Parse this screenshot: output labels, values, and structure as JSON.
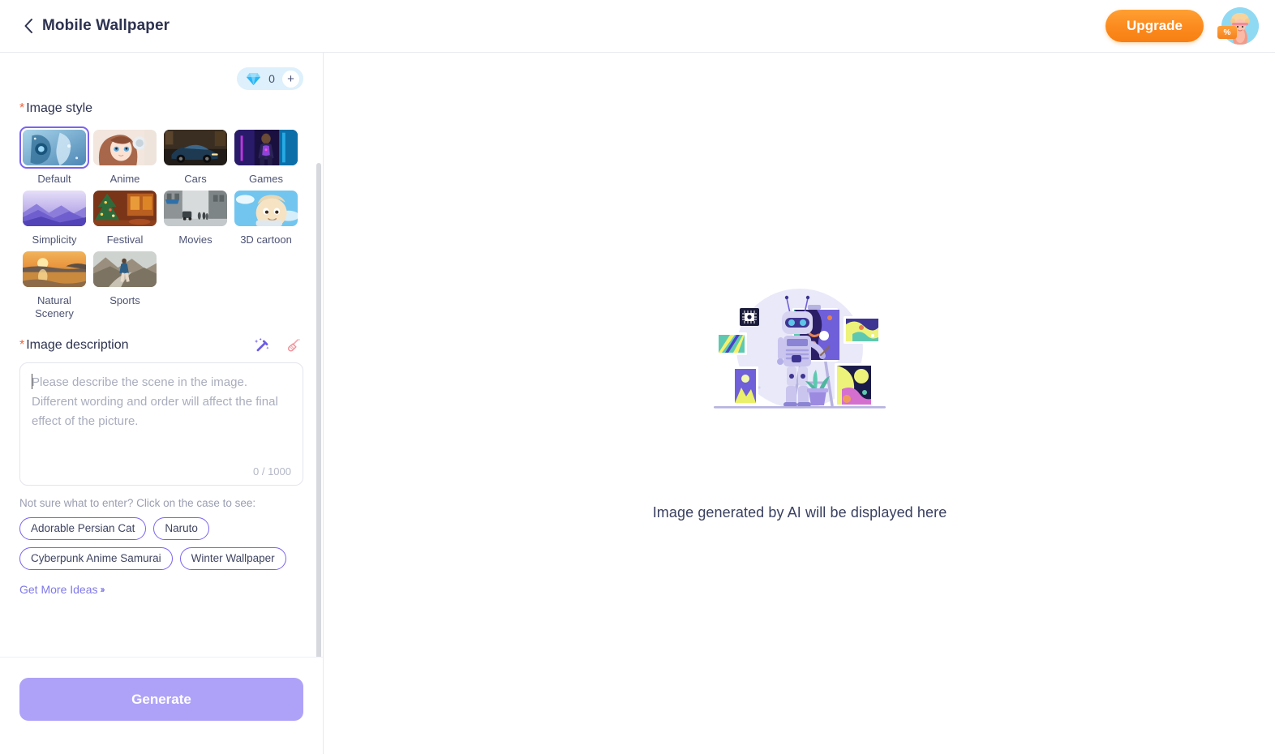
{
  "header": {
    "back_icon": "chevron-left-icon",
    "title": "Mobile Wallpaper",
    "upgrade_label": "Upgrade",
    "avatar_badge": "%",
    "avatar_name": "user-avatar"
  },
  "credits": {
    "icon": "diamond-icon",
    "count": "0",
    "add_label": "+"
  },
  "style_section": {
    "required_mark": "*",
    "label": "Image style",
    "selected_index": 0,
    "items": [
      {
        "label": "Default",
        "thumb": "cyborg-woman-blue"
      },
      {
        "label": "Anime",
        "thumb": "anime-girl-headphones"
      },
      {
        "label": "Cars",
        "thumb": "sports-car-night"
      },
      {
        "label": "Games",
        "thumb": "cyberpunk-game-character"
      },
      {
        "label": "Simplicity",
        "thumb": "purple-minimal-mountains"
      },
      {
        "label": "Festival",
        "thumb": "christmas-tree-warm"
      },
      {
        "label": "Movies",
        "thumb": "rainy-city-street"
      },
      {
        "label": "3D cartoon",
        "thumb": "3d-cartoon-boy-sky"
      },
      {
        "label": "Natural Scenery",
        "thumb": "golden-sunset-sea"
      },
      {
        "label": "Sports",
        "thumb": "runner-mountain-road"
      }
    ]
  },
  "description_section": {
    "required_mark": "*",
    "label": "Image description",
    "magic_icon": "magic-wand-icon",
    "clear_icon": "broom-icon",
    "placeholder": "Please describe the scene in the image. Different wording and order will affect the final effect of the picture.",
    "value": "",
    "char_count": "0 / 1000"
  },
  "examples": {
    "hint": "Not sure what to enter? Click on the case to see:",
    "chips": [
      "Adorable Persian Cat",
      "Naruto",
      "Cyberpunk Anime Samurai",
      "Winter Wallpaper"
    ],
    "more_link": "Get More Ideas",
    "more_chevrons": "»"
  },
  "footer": {
    "generate_label": "Generate"
  },
  "main": {
    "illustration": "robot-painter-gallery-illustration",
    "caption": "Image generated by AI will be displayed here"
  },
  "colors": {
    "accent_purple": "#7a63f0",
    "generate_button": "#aea2f8",
    "upgrade_orange": "#fb8a1e",
    "required_star": "#f0643c",
    "credits_pill": "#ddf0fb",
    "text_primary": "#2d3250",
    "text_muted": "#9a9eb0"
  }
}
